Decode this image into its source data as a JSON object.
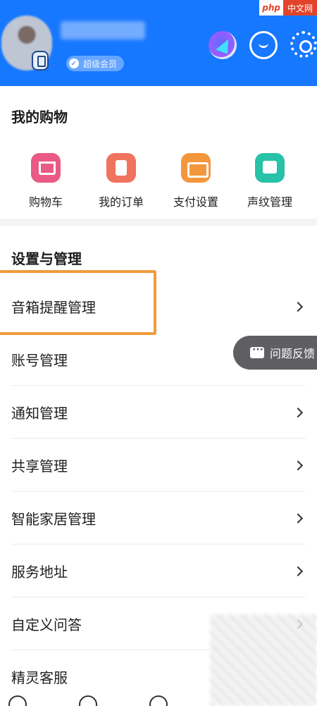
{
  "header": {
    "member_label": "超级会员",
    "member_check": "✓"
  },
  "site_badge": {
    "brand": "php",
    "label": "中文网"
  },
  "shopping": {
    "title": "我的购物",
    "items": [
      {
        "label": "购物车",
        "icon": "shopping-cart-icon",
        "color": "#e95a86"
      },
      {
        "label": "我的订单",
        "icon": "order-icon",
        "color": "#f0735e"
      },
      {
        "label": "支付设置",
        "icon": "payment-card-icon",
        "color": "#f4973c"
      },
      {
        "label": "声纹管理",
        "icon": "voiceprint-icon",
        "color": "#27c2a8"
      }
    ]
  },
  "settings": {
    "title": "设置与管理",
    "items": [
      {
        "label": "音箱提醒管理"
      },
      {
        "label": "账号管理"
      },
      {
        "label": "通知管理"
      },
      {
        "label": "共享管理"
      },
      {
        "label": "智能家居管理"
      },
      {
        "label": "服务地址"
      },
      {
        "label": "自定义问答"
      },
      {
        "label": "精灵客服"
      }
    ]
  },
  "feedback": {
    "label": "问题反馈"
  },
  "colors": {
    "header_bg": "#1677ff",
    "highlight": "#f09a3e",
    "page_bg": "#f4f4f6"
  }
}
